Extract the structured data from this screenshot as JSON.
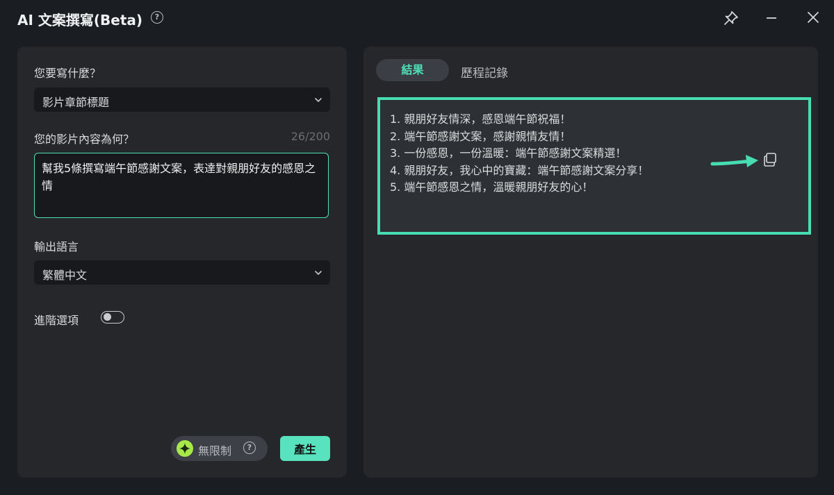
{
  "window": {
    "title": "AI 文案撰寫(Beta)",
    "help_glyph": "?",
    "icons": [
      "help-icon",
      "pin-icon",
      "minimize-icon",
      "close-icon"
    ]
  },
  "form": {
    "topic_label": "您要寫什麼？",
    "topic_value": "影片章節標題",
    "content_label": "您的影片內容為何？",
    "content_counter": "26/200",
    "content_value": "幫我5條撰寫端午節感謝文案，表達對親朋好友的感恩之情",
    "language_label": "輸出語言",
    "language_value": "繁體中文",
    "advanced_label": "進階選項",
    "advanced_enabled": false,
    "unlimited_label": "無限制",
    "generate_label": "產生"
  },
  "results": {
    "tabs": [
      "結果",
      "歷程記錄"
    ],
    "active_tab": 0,
    "items": [
      "1. 親朋好友情深，感恩端午節祝福！",
      "2. 端午節感謝文案，感謝親情友情！",
      "3. 一份感恩，一份溫暖：端午節感謝文案精選！",
      "4. 親朋好友，我心中的寶藏：端午節感謝文案分享！",
      "5. 端午節感恩之情，溫暖親朋好友的心！"
    ]
  },
  "colors": {
    "background": "#1a1d21",
    "panel": "#25272b",
    "accent": "#4fe0b6",
    "highlight_border": "#48dcb2"
  }
}
